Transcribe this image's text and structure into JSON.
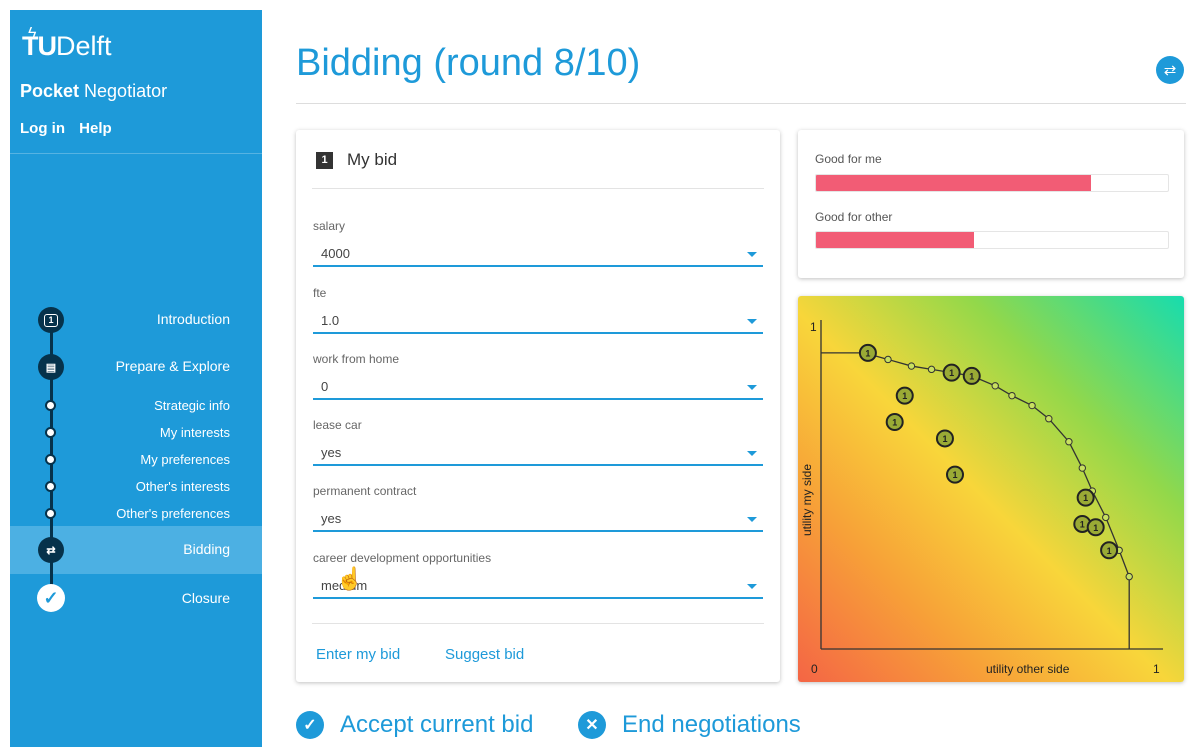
{
  "brand": {
    "logo_tu": "TU",
    "logo_delft": "Delft",
    "app_name_bold": "Pocket",
    "app_name_rest": " Negotiator"
  },
  "nav": {
    "login": "Log in",
    "help": "Help"
  },
  "steps": [
    {
      "label": "Introduction",
      "node": "1"
    },
    {
      "label": "Prepare & Explore"
    },
    {
      "label": "Strategic info"
    },
    {
      "label": "My interests"
    },
    {
      "label": "My preferences"
    },
    {
      "label": "Other's interests"
    },
    {
      "label": "Other's preferences"
    },
    {
      "label": "Bidding"
    },
    {
      "label": "Closure"
    }
  ],
  "title": "Bidding (round 8/10)",
  "bid": {
    "number": "1",
    "header": "My bid",
    "fields": [
      {
        "label": "salary",
        "value": "4000"
      },
      {
        "label": "fte",
        "value": "1.0"
      },
      {
        "label": "work from home",
        "value": "0"
      },
      {
        "label": "lease car",
        "value": "yes"
      },
      {
        "label": "permanent contract",
        "value": "yes"
      },
      {
        "label": "career development opportunities",
        "value": "medium"
      }
    ],
    "enter_label": "Enter my bid",
    "suggest_label": "Suggest bid"
  },
  "meters": {
    "good_for_me": {
      "label": "Good for me",
      "value": 0.78
    },
    "good_for_other": {
      "label": "Good for other",
      "value": 0.45
    }
  },
  "chart_data": {
    "type": "scatter",
    "xlabel": "utility other side",
    "ylabel": "utility my side",
    "x_tick_min": "0",
    "x_tick_max": "1",
    "y_tick_max": "1",
    "xlim": [
      0,
      1
    ],
    "ylim": [
      0,
      1
    ],
    "pareto_frontier": [
      {
        "x": 0.0,
        "y": 0.9
      },
      {
        "x": 0.13,
        "y": 0.9
      },
      {
        "x": 0.2,
        "y": 0.88
      },
      {
        "x": 0.27,
        "y": 0.86
      },
      {
        "x": 0.33,
        "y": 0.85
      },
      {
        "x": 0.39,
        "y": 0.84
      },
      {
        "x": 0.45,
        "y": 0.83
      },
      {
        "x": 0.52,
        "y": 0.8
      },
      {
        "x": 0.57,
        "y": 0.77
      },
      {
        "x": 0.63,
        "y": 0.74
      },
      {
        "x": 0.68,
        "y": 0.7
      },
      {
        "x": 0.74,
        "y": 0.63
      },
      {
        "x": 0.78,
        "y": 0.55
      },
      {
        "x": 0.81,
        "y": 0.48
      },
      {
        "x": 0.85,
        "y": 0.4
      },
      {
        "x": 0.89,
        "y": 0.3
      },
      {
        "x": 0.92,
        "y": 0.22
      },
      {
        "x": 0.92,
        "y": 0.0
      }
    ],
    "bids": [
      {
        "x": 0.14,
        "y": 0.9
      },
      {
        "x": 0.39,
        "y": 0.84
      },
      {
        "x": 0.45,
        "y": 0.83
      },
      {
        "x": 0.25,
        "y": 0.77
      },
      {
        "x": 0.22,
        "y": 0.69
      },
      {
        "x": 0.37,
        "y": 0.64
      },
      {
        "x": 0.4,
        "y": 0.53
      },
      {
        "x": 0.79,
        "y": 0.46
      },
      {
        "x": 0.78,
        "y": 0.38
      },
      {
        "x": 0.82,
        "y": 0.37
      },
      {
        "x": 0.86,
        "y": 0.3
      }
    ],
    "bid_label": "1"
  },
  "actions": {
    "accept": "Accept current bid",
    "end": "End negotiations"
  }
}
